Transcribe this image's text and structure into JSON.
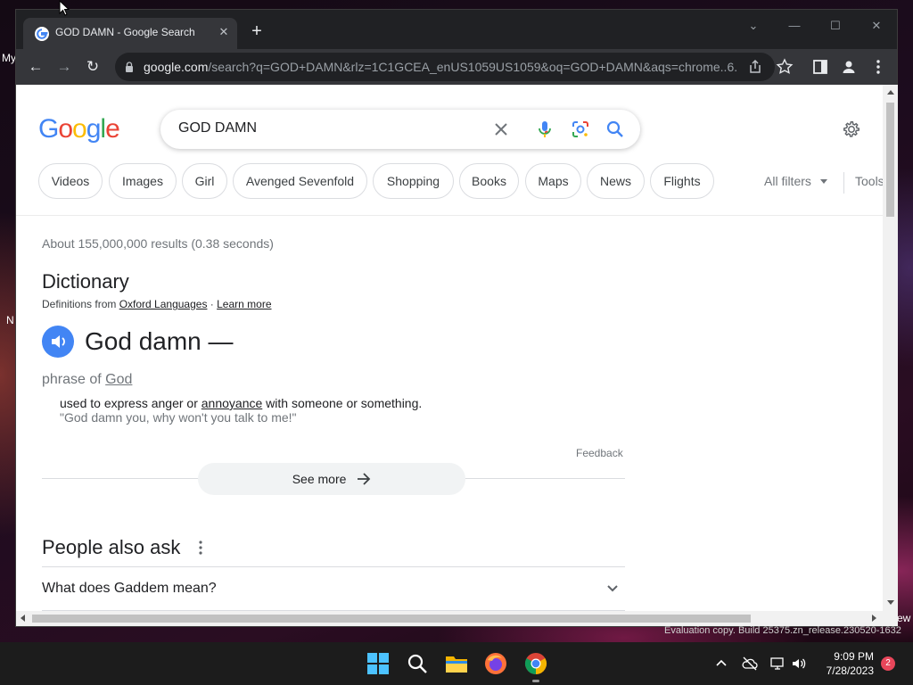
{
  "desktop": {
    "labels": [
      "My",
      "N",
      "ew"
    ],
    "watermark": "Evaluation copy. Build 25375.zn_release.230520-1632"
  },
  "browser": {
    "tab": {
      "title": "GOD DAMN - Google Search",
      "close": "✕"
    },
    "new_tab": "+",
    "window_controls": {
      "minimize": "—",
      "maximize": "☐",
      "close": "✕",
      "dropdown": "⌄"
    },
    "nav": {
      "back": "←",
      "forward": "→",
      "reload": "↻"
    },
    "url": {
      "domain": "google.com",
      "path": "/search?q=GOD+DAMN&rlz=1C1GCEA_enUS1059US1059&oq=GOD+DAMN&aqs=chrome..6..."
    }
  },
  "search": {
    "logo_letters": [
      "G",
      "o",
      "o",
      "g",
      "l",
      "e"
    ],
    "query": "GOD DAMN",
    "chips": [
      "Videos",
      "Images",
      "Girl",
      "Avenged Sevenfold",
      "Shopping",
      "Books",
      "Maps",
      "News",
      "Flights"
    ],
    "all_filters": "All filters",
    "tools": "Tools",
    "stats": "About 155,000,000 results (0.38 seconds)"
  },
  "dictionary": {
    "title": "Dictionary",
    "defs_prefix": "Definitions from ",
    "source": "Oxford Languages",
    "separator": " · ",
    "learn_more": "Learn more",
    "headword": "God damn —",
    "phrase_prefix": "phrase of ",
    "phrase_link": "God",
    "definition_before": "used to express anger or ",
    "definition_link": "annoyance",
    "definition_after": " with someone or something.",
    "example": "\"God damn you, why won't you talk to me!\"",
    "feedback": "Feedback",
    "see_more": "See more"
  },
  "people_also_ask": {
    "title": "People also ask",
    "questions": [
      "What does Gaddem mean?"
    ]
  },
  "taskbar": {
    "time": "9:09 PM",
    "date": "7/28/2023",
    "notifications": "2"
  },
  "colors": {
    "google_blue": "#4285f4",
    "chrome_dark": "#202124",
    "chrome_toolbar": "#35363a"
  }
}
